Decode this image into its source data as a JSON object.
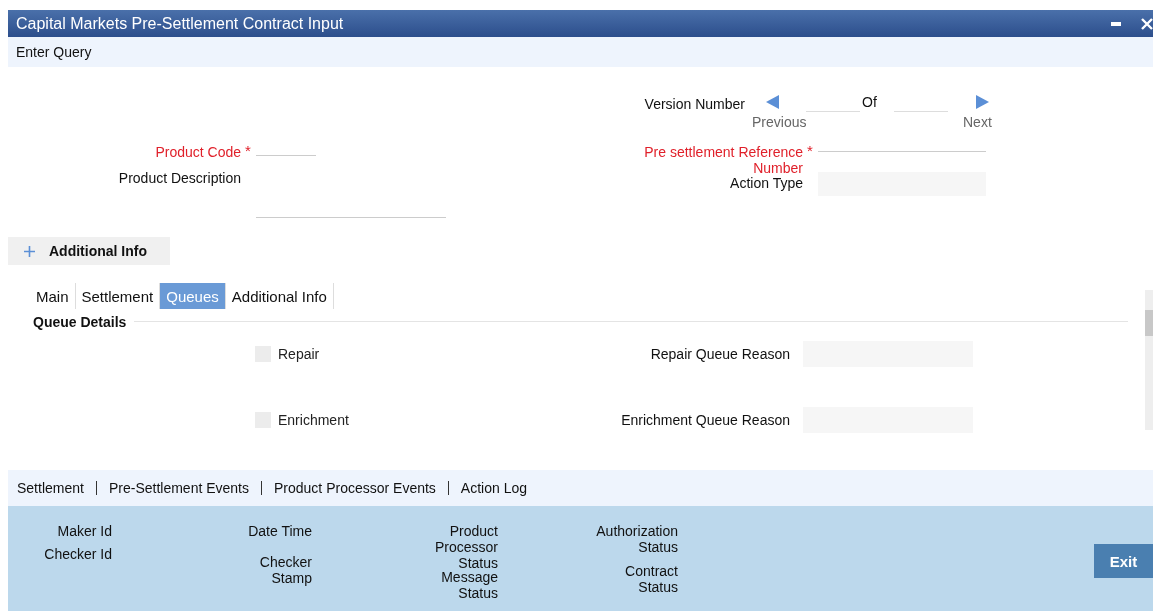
{
  "window": {
    "title": "Capital Markets Pre-Settlement Contract Input"
  },
  "toolbar": {
    "items": [
      "Enter Query"
    ]
  },
  "version": {
    "label": "Version Number",
    "of_label": "Of",
    "previous_label": "Previous",
    "next_label": "Next"
  },
  "left_fields": [
    {
      "label": "Product Code",
      "required": true,
      "mark": "*",
      "kind": "line"
    },
    {
      "label": "Product Description",
      "required": false,
      "kind": "line"
    }
  ],
  "right_fields": [
    {
      "label": "Pre settlement Reference Number",
      "required": true,
      "mark": "*",
      "kind": "line"
    },
    {
      "label": "Action Type",
      "required": false,
      "kind": "box"
    }
  ],
  "additional_info": {
    "label": "Additional Info",
    "expanded": false
  },
  "tabs": [
    {
      "label": "Main",
      "selected": false
    },
    {
      "label": "Settlement",
      "selected": false
    },
    {
      "label": "Queues",
      "selected": true
    },
    {
      "label": "Additional Info",
      "selected": false
    }
  ],
  "queue_details": {
    "title": "Queue Details",
    "queues": [
      {
        "label": "Repair",
        "checked": false,
        "disabled": true,
        "reason_label": "Repair Queue Reason"
      },
      {
        "label": "Enrichment",
        "checked": false,
        "disabled": true,
        "reason_label": "Enrichment Queue Reason"
      }
    ]
  },
  "footer_links": [
    "Settlement",
    "Pre-Settlement Events",
    "Product Processor Events",
    "Action Log"
  ],
  "audit": {
    "columns": [
      [
        "Maker Id",
        "Checker Id"
      ],
      [
        "Date Time",
        "Checker Stamp"
      ],
      [
        "Product Processor Status",
        "Message Status"
      ],
      [
        "Authorization Status",
        "Contract Status"
      ]
    ],
    "exit_label": "Exit"
  }
}
